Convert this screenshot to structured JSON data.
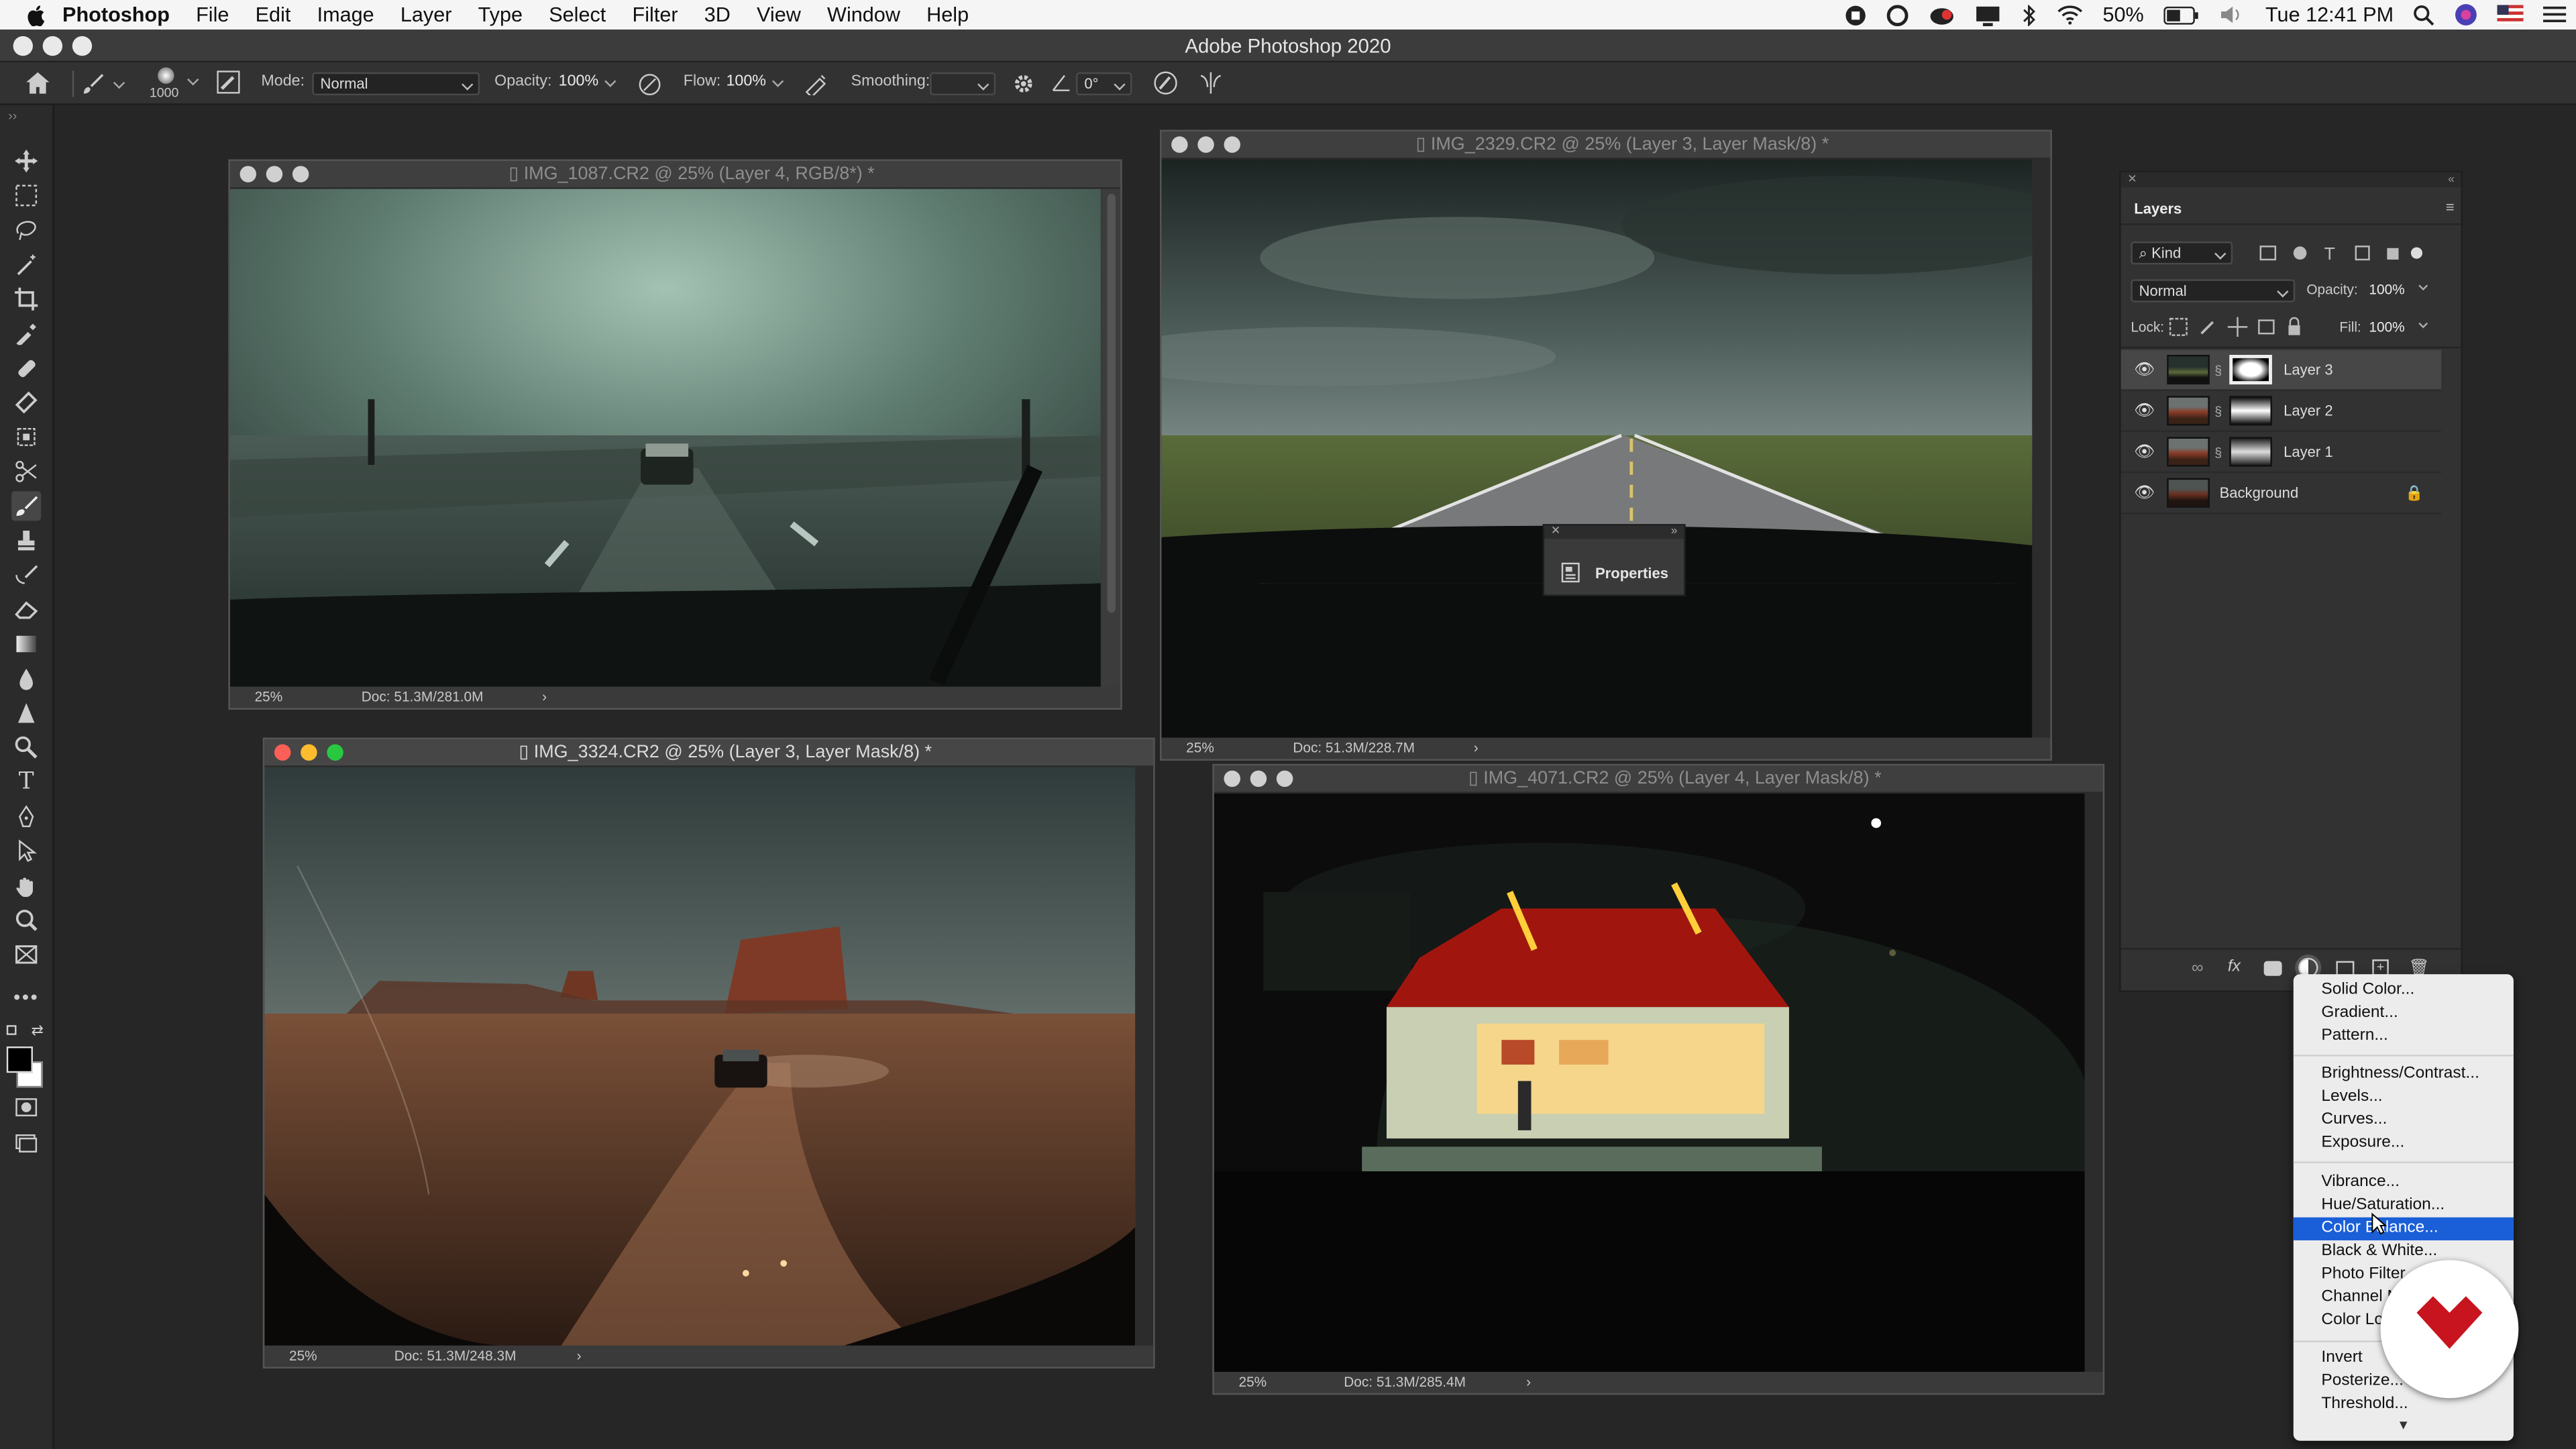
{
  "menubar": {
    "app": "Photoshop",
    "items": [
      "File",
      "Edit",
      "Image",
      "Layer",
      "Type",
      "Select",
      "Filter",
      "3D",
      "View",
      "Window",
      "Help"
    ],
    "battery": "50%",
    "clock": "Tue 12:41 PM"
  },
  "window": {
    "title": "Adobe Photoshop 2020"
  },
  "options": {
    "brush_size": "1000",
    "mode_label": "Mode:",
    "mode_value": "Normal",
    "opacity_label": "Opacity:",
    "opacity_value": "100%",
    "flow_label": "Flow:",
    "flow_value": "100%",
    "smoothing_label": "Smoothing:",
    "smoothing_value": "",
    "angle_value": "0°"
  },
  "docs": [
    {
      "title": "IMG_1087.CR2 @ 25% (Layer 4, RGB/8*) *",
      "zoom": "25%",
      "doc": "Doc: 51.3M/281.0M"
    },
    {
      "title": "IMG_2329.CR2 @ 25% (Layer 3, Layer Mask/8) *",
      "zoom": "25%",
      "doc": "Doc: 51.3M/228.7M"
    },
    {
      "title": "IMG_3324.CR2 @ 25% (Layer 3, Layer Mask/8) *",
      "zoom": "25%",
      "doc": "Doc: 51.3M/248.3M"
    },
    {
      "title": "IMG_4071.CR2 @ 25% (Layer 4, Layer Mask/8) *",
      "zoom": "25%",
      "doc": "Doc: 51.3M/285.4M"
    }
  ],
  "properties": {
    "label": "Properties"
  },
  "layers_panel": {
    "title": "Layers",
    "kind": "Kind",
    "blend": "Normal",
    "opacity_label": "Opacity:",
    "opacity_value": "100%",
    "lock_label": "Lock:",
    "fill_label": "Fill:",
    "fill_value": "100%",
    "layers": [
      {
        "name": "Layer 3"
      },
      {
        "name": "Layer 2"
      },
      {
        "name": "Layer 1"
      },
      {
        "name": "Background"
      }
    ],
    "footer_fx": "fx"
  },
  "adjust_menu": {
    "items": [
      "Solid Color...",
      "Gradient...",
      "Pattern...",
      "Brightness/Contrast...",
      "Levels...",
      "Curves...",
      "Exposure...",
      "Vibrance...",
      "Hue/Saturation...",
      "Color Balance...",
      "Black & White...",
      "Photo Filter...",
      "Channel Mixer...",
      "Color Lookup...",
      "Invert",
      "Posterize...",
      "Threshold..."
    ],
    "selected": "Color Balance..."
  },
  "colors": {
    "accent": "#1a5fd8",
    "logo_red": "#c8141e"
  }
}
